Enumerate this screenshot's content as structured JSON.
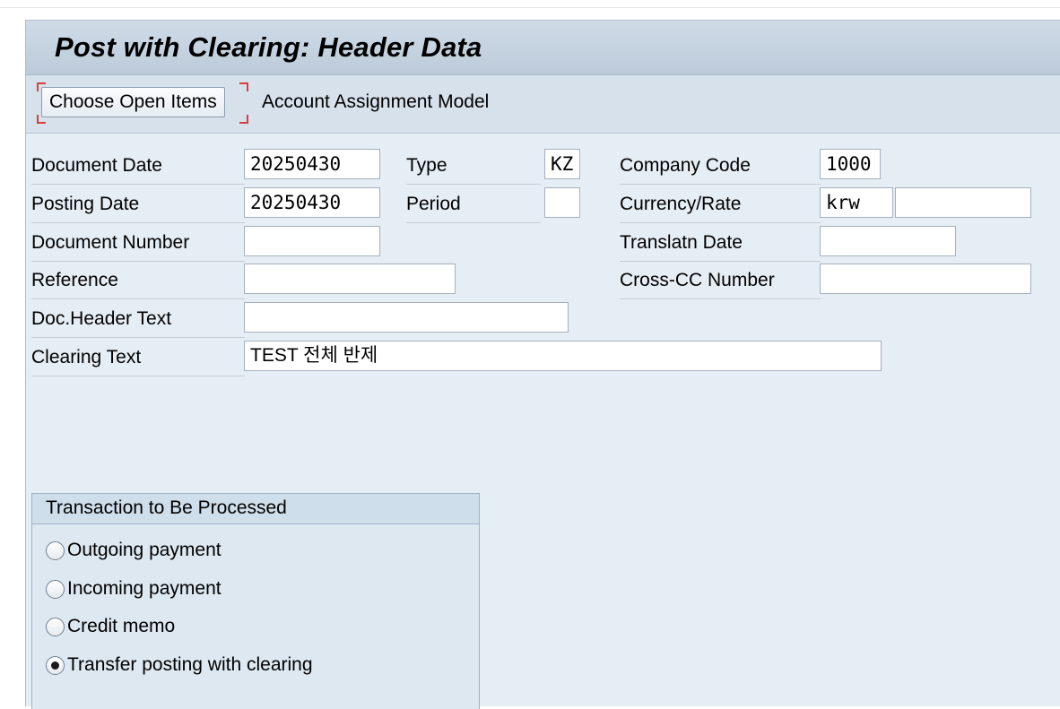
{
  "title": "Post with Clearing: Header Data",
  "toolbar": {
    "choose_open_items": "Choose Open Items",
    "account_assignment_model": "Account Assignment Model"
  },
  "fields": {
    "document_date": {
      "label": "Document Date",
      "value": "20250430"
    },
    "type": {
      "label": "Type",
      "value": "KZ"
    },
    "company_code": {
      "label": "Company Code",
      "value": "1000"
    },
    "posting_date": {
      "label": "Posting Date",
      "value": "20250430"
    },
    "period": {
      "label": "Period",
      "value": ""
    },
    "currency_rate": {
      "label": "Currency/Rate",
      "currency": "krw",
      "rate": ""
    },
    "document_number": {
      "label": "Document Number",
      "value": ""
    },
    "translation_date": {
      "label": "Translatn Date",
      "value": ""
    },
    "reference": {
      "label": "Reference",
      "value": ""
    },
    "cross_cc_number": {
      "label": "Cross-CC Number",
      "value": ""
    },
    "doc_header_text": {
      "label": "Doc.Header Text",
      "value": ""
    },
    "clearing_text": {
      "label": "Clearing Text",
      "value": "TEST 전체 반제"
    }
  },
  "transaction_group": {
    "title": "Transaction to Be Processed",
    "options": [
      {
        "label": "Outgoing payment",
        "selected": false
      },
      {
        "label": "Incoming payment",
        "selected": false
      },
      {
        "label": "Credit memo",
        "selected": false
      },
      {
        "label": "Transfer posting with clearing",
        "selected": true
      }
    ]
  }
}
